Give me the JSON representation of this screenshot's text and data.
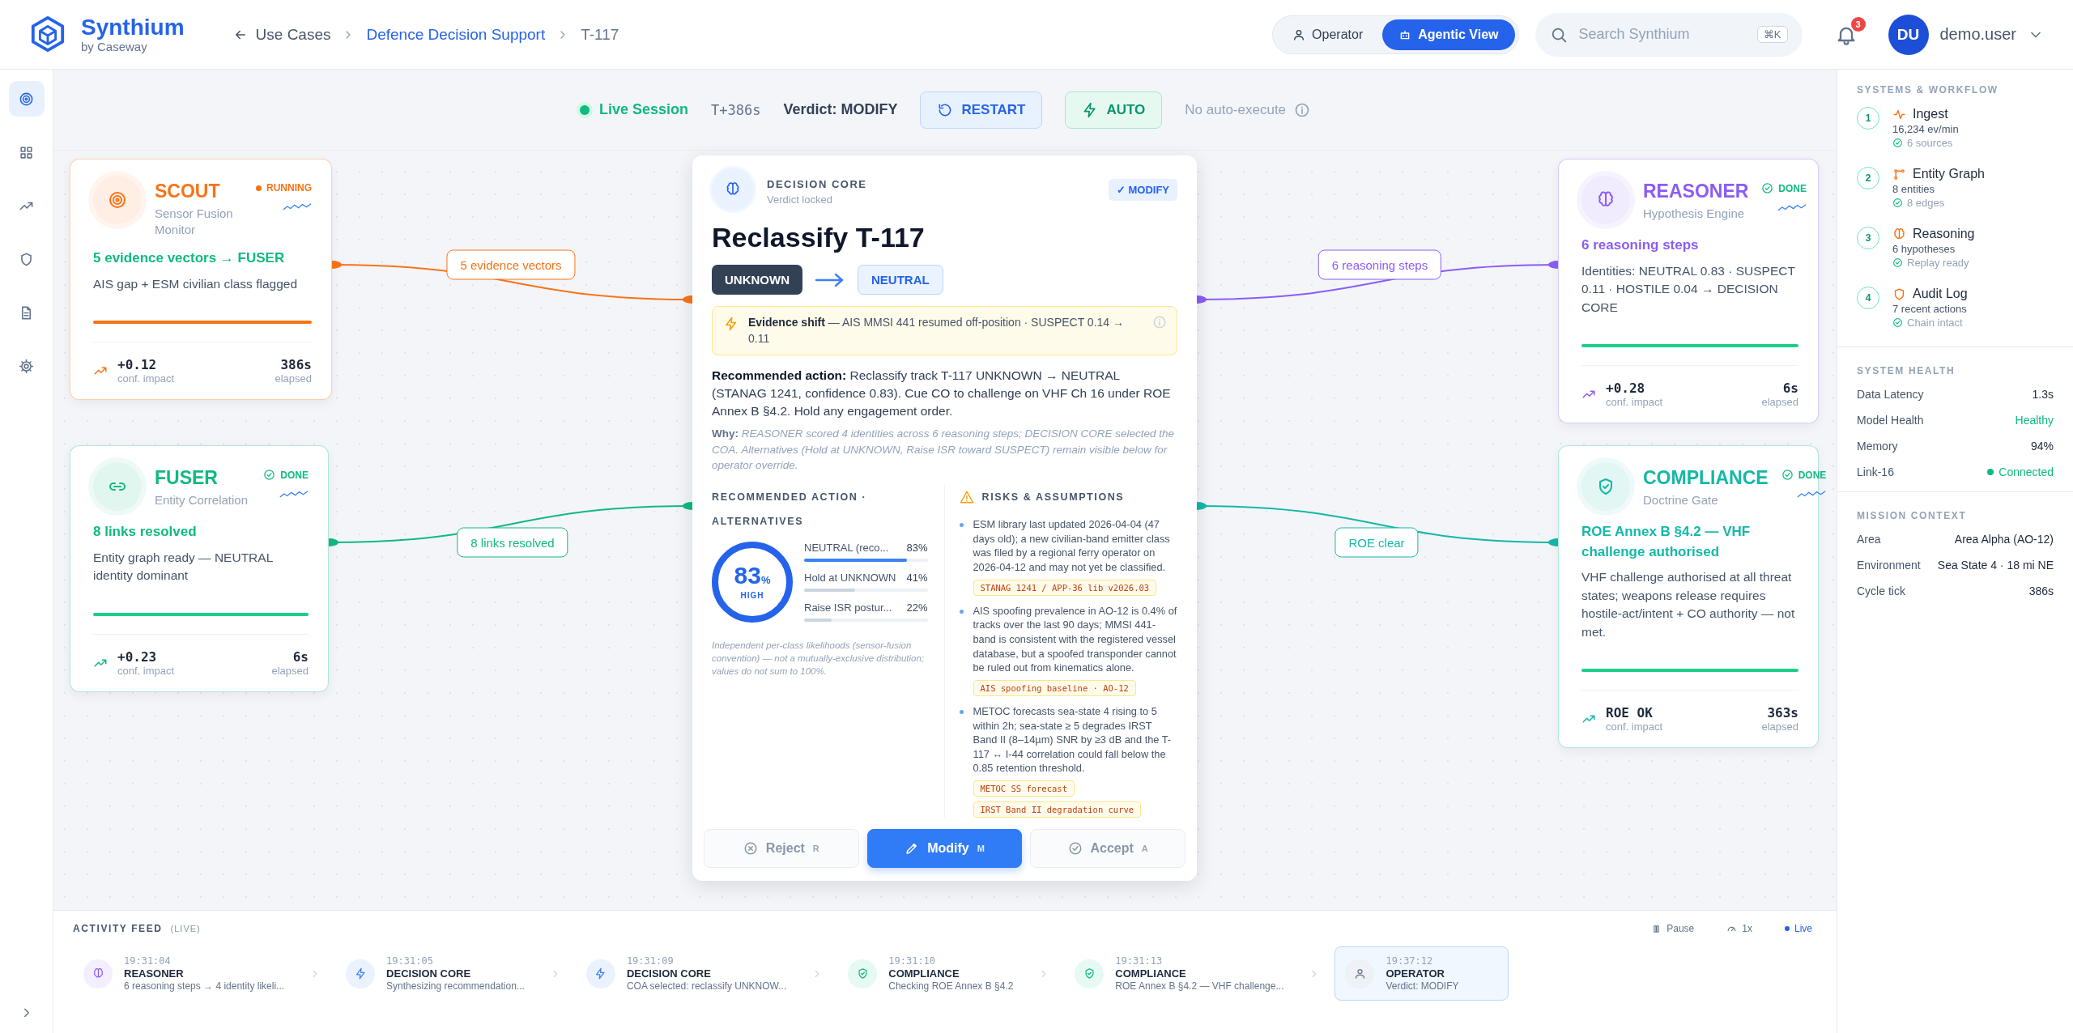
{
  "header": {
    "logo": "Synthium",
    "tagline": "by Caseway",
    "breadcrumbs": [
      {
        "label": "Use Cases",
        "kind": "back"
      },
      {
        "label": "Defence Decision Support",
        "kind": "link"
      },
      {
        "label": "T-117",
        "kind": "current"
      }
    ],
    "view_toggle": [
      {
        "label": "Operator",
        "selected": false
      },
      {
        "label": "Agentic View",
        "selected": true
      }
    ],
    "search": {
      "placeholder": "Search Synthium",
      "shortcut": "⌘K"
    },
    "notifications": "3",
    "user": {
      "initials": "DU",
      "name": "demo.user"
    }
  },
  "rail": [
    {
      "selected": true
    },
    {
      "selected": false
    },
    {
      "selected": false
    },
    {
      "selected": false
    },
    {
      "selected": false
    },
    {
      "selected": false
    }
  ],
  "session": {
    "status": "Live Session",
    "time": "T+386s",
    "verdict": "Verdict: MODIFY",
    "buttons": [
      {
        "label": "RESTART",
        "kind": "restart"
      },
      {
        "label": "AUTO",
        "kind": "auto"
      }
    ],
    "note": "No auto-execute"
  },
  "agents": [
    {
      "name": "SCOUT",
      "subtitle": "Sensor Fusion Monitor",
      "status": "RUNNING",
      "kind": "running",
      "color": "#f97316",
      "headline": "5 evidence vectors → FUSER",
      "description": "AIS gap + ESM civilian class flagged",
      "level": 1,
      "impact": "+0.12",
      "impact_label": "conf. impact",
      "elapsed": "386s",
      "elapsed_label": "elapsed",
      "edge_label": "5 evidence vectors"
    },
    {
      "name": "FUSER",
      "subtitle": "Entity Correlation",
      "status": "DONE",
      "kind": "done",
      "color": "#10b981",
      "headline": "8 links resolved",
      "description": "Entity graph ready — NEUTRAL identity dominant",
      "level": 1,
      "impact": "+0.23",
      "impact_label": "conf. impact",
      "elapsed": "6s",
      "elapsed_label": "elapsed",
      "edge_label": "8 links resolved"
    },
    {
      "name": "REASONER",
      "subtitle": "Hypothesis Engine",
      "status": "DONE",
      "kind": "done",
      "color": "#8b5cf6",
      "headline": "6 reasoning steps",
      "description": "Identities: NEUTRAL 0.83 · SUSPECT 0.11 · HOSTILE 0.04 → DECISION CORE",
      "level": 1,
      "impact": "+0.28",
      "impact_label": "conf. impact",
      "elapsed": "6s",
      "elapsed_label": "elapsed",
      "edge_label": "6 reasoning steps"
    },
    {
      "name": "COMPLIANCE",
      "subtitle": "Doctrine Gate",
      "status": "DONE",
      "kind": "done",
      "color": "#14b8a6",
      "headline": "ROE Annex B §4.2 — VHF challenge authorised",
      "description": "VHF challenge authorised at all threat states; weapons release requires hostile-act/intent + CO authority — not met.",
      "level": 1,
      "impact": "ROE OK",
      "impact_label": "conf. impact",
      "elapsed": "363s",
      "elapsed_label": "elapsed",
      "edge_label": "ROE clear"
    }
  ],
  "decision": {
    "label": "DECISION CORE",
    "sublabel": "Verdict locked",
    "verdict_badge": "✓ MODIFY",
    "title": "Reclassify T-117",
    "from": "UNKNOWN",
    "to": "NEUTRAL",
    "alert": "**Evidence shift** — AIS MMSI 441 resumed off-position · SUSPECT 0.14 → 0.11",
    "recommendation": "**Recommended action:** Reclassify track T-117 UNKNOWN → NEUTRAL (STANAG 1241, confidence 0.83). Cue CO to challenge on VHF Ch 16 under ROE Annex B §4.2. Hold any engagement order.",
    "why": "**Why:** *REASONER scored 4 identities across 6 reasoning steps; DECISION CORE selected the COA. Alternatives (Hold at UNKNOWN, Raise ISR toward SUSPECT) remain visible below for operator override.*",
    "alternatives_title": "RECOMMENDED ACTION · ALTERNATIVES",
    "confidence": {
      "value": "83",
      "unit": "%",
      "label": "HIGH"
    },
    "alternatives": [
      {
        "label": "NEUTRAL (reco...",
        "value": "83%",
        "level": 0.83,
        "selected": true
      },
      {
        "label": "Hold at UNKNOWN",
        "value": "41%",
        "level": 0.41,
        "selected": false
      },
      {
        "label": "Raise ISR postur...",
        "value": "22%",
        "level": 0.22,
        "selected": false
      }
    ],
    "footnote": "Independent per-class likelihoods (sensor-fusion convention) — not a mutually-exclusive distribution; values do not sum to 100%.",
    "risks_title": "RISKS & ASSUMPTIONS",
    "risks": [
      {
        "text": "ESM library last updated 2026-04-04 (47 days old); a new civilian-band emitter class was filed by a regional ferry operator on 2026-04-12 and may not yet be classified.",
        "tags": [
          "STANAG 1241 / APP-36 lib v2026.03"
        ]
      },
      {
        "text": "AIS spoofing prevalence in AO-12 is 0.4% of tracks over the last 90 days; MMSI 441-band is consistent with the registered vessel database, but a spoofed transponder cannot be ruled out from kinematics alone.",
        "tags": [
          "AIS spoofing baseline · AO-12"
        ]
      },
      {
        "text": "METOC forecasts sea-state 4 rising to 5 within 2h; sea-state ≥ 5 degrades IRST Band II (8–14µm) SNR by ≥3 dB and the T-117 ↔ I-44 correlation could fall below the 0.85 retention threshold.",
        "tags": [
          "METOC SS forecast",
          "IRST Band II degradation curve"
        ]
      }
    ],
    "actions": [
      {
        "label": "Reject",
        "key": "R",
        "kind": "reject",
        "disabled": true
      },
      {
        "label": "Modify",
        "key": "M",
        "kind": "modify",
        "disabled": false
      },
      {
        "label": "Accept",
        "key": "A",
        "kind": "accept",
        "disabled": true
      }
    ]
  },
  "sidebar": {
    "workflow_title": "SYSTEMS & WORKFLOW",
    "steps": [
      {
        "number": "1",
        "name": "Ingest",
        "detail": "16,234 ev/min",
        "check": "6 sources"
      },
      {
        "number": "2",
        "name": "Entity Graph",
        "detail": "8 entities",
        "check": "8 edges"
      },
      {
        "number": "3",
        "name": "Reasoning",
        "detail": "6 hypotheses",
        "check": "Replay ready"
      },
      {
        "number": "4",
        "name": "Audit Log",
        "detail": "7 recent actions",
        "check": "Chain intact"
      }
    ],
    "health_title": "SYSTEM HEALTH",
    "health": [
      {
        "label": "Data Latency",
        "value": "1.3s",
        "kind": "plain"
      },
      {
        "label": "Model Health",
        "value": "Healthy",
        "kind": "good"
      },
      {
        "label": "Memory",
        "value": "94%",
        "kind": "plain"
      },
      {
        "label": "Link-16",
        "value": "Connected",
        "kind": "status"
      }
    ],
    "mission_title": "MISSION CONTEXT",
    "mission": [
      {
        "label": "Area",
        "value": "Area Alpha (AO-12)"
      },
      {
        "label": "Environment",
        "value": "Sea State 4 · 18 mi NE"
      },
      {
        "label": "Cycle tick",
        "value": "386s"
      }
    ]
  },
  "feed": {
    "title": "ACTIVITY FEED",
    "tag": "(LIVE)",
    "controls": [
      {
        "label": "Pause",
        "kind": "pause",
        "selected": false
      },
      {
        "label": "1x",
        "kind": "speed",
        "selected": false
      },
      {
        "label": "Live",
        "kind": "live",
        "selected": true
      }
    ],
    "items": [
      {
        "time": "19:31:04",
        "agent": "REASONER",
        "text": "6 reasoning steps → 4 identity likeli...",
        "kind": "reasoner",
        "selected": false
      },
      {
        "time": "19:31:05",
        "agent": "DECISION CORE",
        "text": "Synthesizing recommendation...",
        "kind": "decision",
        "selected": false
      },
      {
        "time": "19:31:09",
        "agent": "DECISION CORE",
        "text": "COA selected: reclassify UNKNOW...",
        "kind": "decision",
        "selected": false
      },
      {
        "time": "19:31:10",
        "agent": "COMPLIANCE",
        "text": "Checking ROE Annex B §4.2",
        "kind": "compliance",
        "selected": false
      },
      {
        "time": "19:31:13",
        "agent": "COMPLIANCE",
        "text": "ROE Annex B §4.2 — VHF challenge...",
        "kind": "compliance",
        "selected": false
      },
      {
        "time": "19:37:12",
        "agent": "OPERATOR",
        "text": "Verdict: MODIFY",
        "kind": "operator",
        "selected": true
      }
    ]
  }
}
